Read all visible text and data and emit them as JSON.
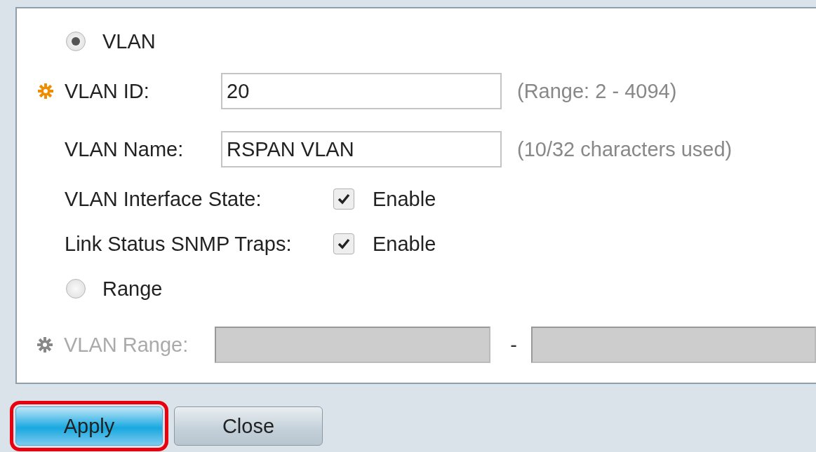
{
  "vlan_option": {
    "label": "VLAN",
    "selected": true
  },
  "fields": [
    {
      "kind": "text",
      "label": "VLAN ID:",
      "required": true,
      "value": "20",
      "hint": "(Range: 2 - 4094)"
    },
    {
      "kind": "text",
      "label": "VLAN Name:",
      "required": false,
      "value": "RSPAN VLAN",
      "hint": "(10/32 characters used)"
    },
    {
      "kind": "checkbox",
      "label": "VLAN Interface State:",
      "checked": true,
      "option": "Enable"
    },
    {
      "kind": "checkbox",
      "label": "Link Status SNMP Traps:",
      "checked": true,
      "option": "Enable"
    }
  ],
  "range_option": {
    "label": "Range",
    "selected": false
  },
  "range_field": {
    "label": "VLAN Range:",
    "disabled": true,
    "separator": "-"
  },
  "buttons": [
    {
      "label": "Apply",
      "highlighted": true
    },
    {
      "label": "Close",
      "highlighted": false
    }
  ]
}
